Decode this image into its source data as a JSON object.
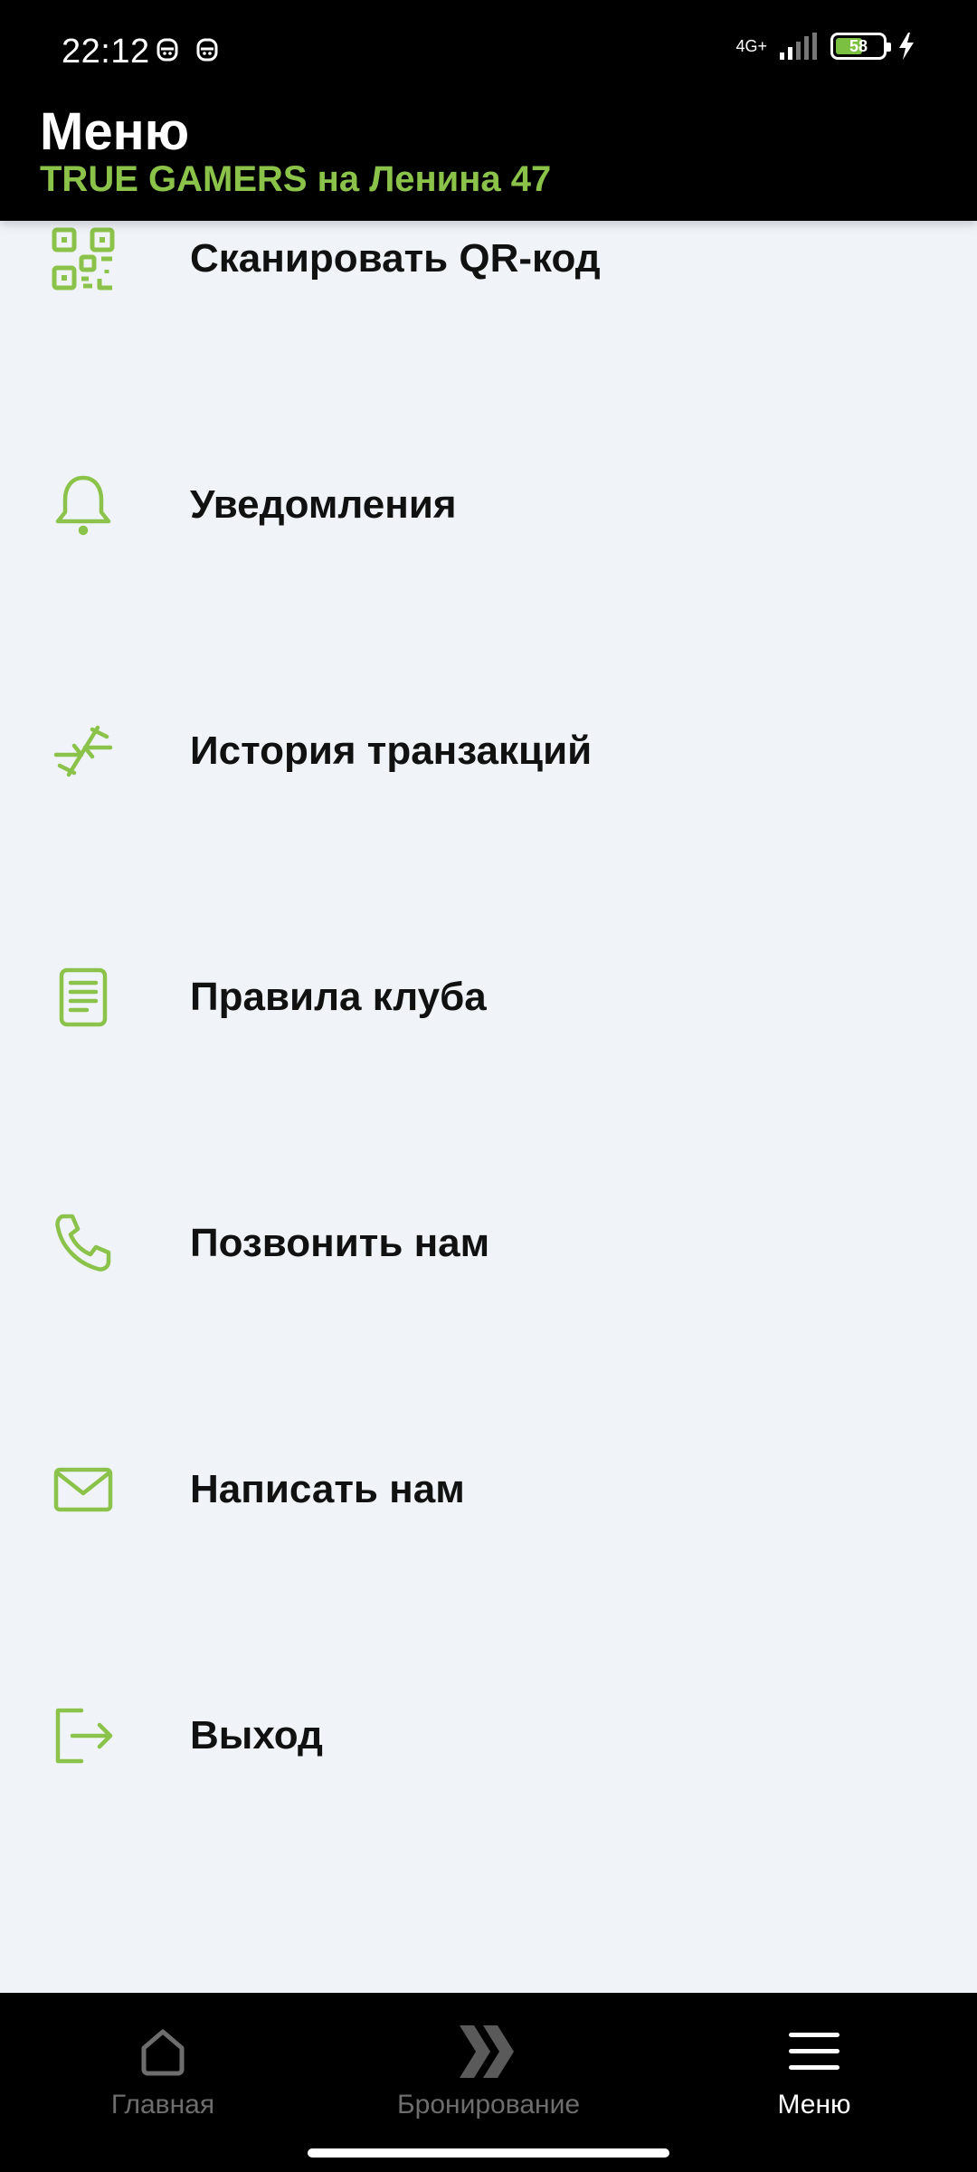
{
  "status_bar": {
    "time": "22:12",
    "network": "4G+",
    "battery": "58",
    "battery_level": 0.58,
    "icons": [
      "notification-icon",
      "notification-icon",
      "signal-icon",
      "battery-icon",
      "charging-icon"
    ]
  },
  "header": {
    "title": "Меню",
    "subtitle": "TRUE GAMERS на Ленина 47"
  },
  "menu": {
    "items": [
      {
        "label": "Сканировать QR-код",
        "icon": "qr-code-icon"
      },
      {
        "label": "Уведомления",
        "icon": "bell-icon"
      },
      {
        "label": "История транзакций",
        "icon": "transactions-icon"
      },
      {
        "label": "Правила клуба",
        "icon": "document-icon"
      },
      {
        "label": "Позвонить нам",
        "icon": "phone-icon"
      },
      {
        "label": "Написать нам",
        "icon": "mail-icon"
      },
      {
        "label": "Выход",
        "icon": "logout-icon"
      }
    ]
  },
  "bottom_nav": {
    "items": [
      {
        "label": "Главная",
        "icon": "home-icon",
        "active": false
      },
      {
        "label": "Бронирование",
        "icon": "booking-chevrons-icon",
        "active": false
      },
      {
        "label": "Меню",
        "icon": "hamburger-menu-icon",
        "active": true
      }
    ]
  },
  "colors": {
    "accent": "#8bc34a",
    "header_bg": "#000000",
    "page_bg": "#f0f4f9",
    "inactive_nav": "#6d6d6d"
  }
}
